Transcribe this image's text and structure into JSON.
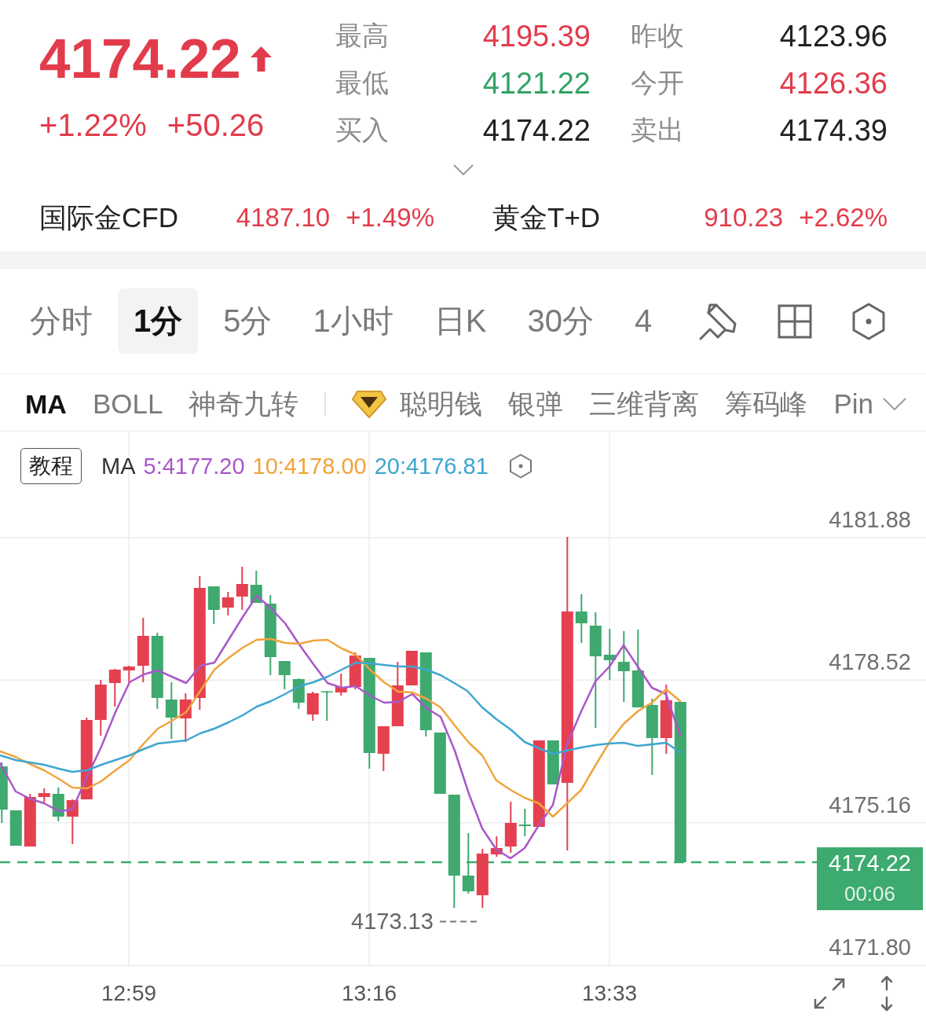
{
  "quote": {
    "price": "4174.22",
    "rising": true,
    "change_percent": "+1.22%",
    "change": "+50.26",
    "stats": [
      {
        "label": "最高",
        "value": "4195.39",
        "color": "#e23c4c"
      },
      {
        "label": "昨收",
        "value": "4123.96",
        "color": "#222222"
      },
      {
        "label": "最低",
        "value": "4121.22",
        "color": "#34a266"
      },
      {
        "label": "今开",
        "value": "4126.36",
        "color": "#e23c4c"
      },
      {
        "label": "买入",
        "value": "4174.22",
        "color": "#222222"
      },
      {
        "label": "卖出",
        "value": "4174.39",
        "color": "#222222"
      }
    ]
  },
  "related": [
    {
      "name": "国际金CFD",
      "price": "4187.10",
      "change": "+1.49%",
      "color": "#e23c4c"
    },
    {
      "name": "黄金T+D",
      "price": "910.23",
      "change": "+2.62%",
      "color": "#e23c4c"
    }
  ],
  "period_tabs": [
    {
      "label": "分时",
      "selected": false
    },
    {
      "label": "1分",
      "selected": true
    },
    {
      "label": "5分",
      "selected": false
    },
    {
      "label": "1小时",
      "selected": false
    },
    {
      "label": "日K",
      "selected": false
    },
    {
      "label": "30分",
      "selected": false
    },
    {
      "label": "4",
      "selected": false
    }
  ],
  "indicators": {
    "main": [
      {
        "label": "MA",
        "selected": true
      },
      {
        "label": "BOLL",
        "selected": false
      },
      {
        "label": "神奇九转",
        "selected": false
      }
    ],
    "extra": [
      {
        "label": "聪明钱",
        "kind": "premium",
        "selected": false
      },
      {
        "label": "银弹",
        "kind": "plain",
        "selected": false
      },
      {
        "label": "三维背离",
        "kind": "plain",
        "selected": false
      },
      {
        "label": "筹码峰",
        "kind": "plain",
        "selected": false
      },
      {
        "label": "Pin",
        "kind": "plain",
        "selected": false
      }
    ]
  },
  "chart": {
    "tutorial_button": "教程",
    "legend_title": "MA",
    "ma": [
      {
        "label": "5:4177.20",
        "color": "#a957ca"
      },
      {
        "label": "10:4178.00",
        "color": "#f0a43c"
      },
      {
        "label": "20:4176.81",
        "color": "#3ea6cf"
      }
    ],
    "y_labels": [
      "4181.88",
      "4178.52",
      "4175.16",
      "4171.80"
    ],
    "last_price": "4174.22",
    "countdown": "00:06",
    "low_label": "4173.13",
    "x_labels": [
      "12:59",
      "13:16",
      "13:33"
    ]
  }
}
